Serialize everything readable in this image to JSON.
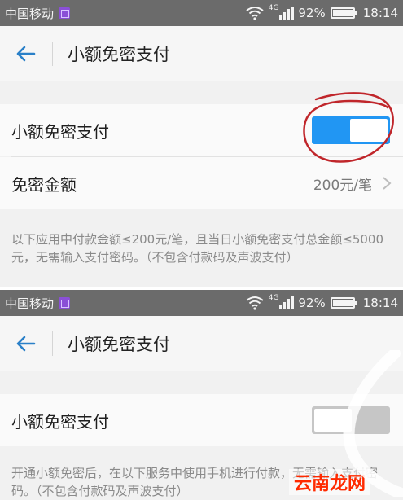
{
  "status_bar": {
    "carrier": "中国移动",
    "network": "4G",
    "battery": "92%",
    "battery_level": 0.92,
    "time": "18:14"
  },
  "header": {
    "title": "小额免密支付"
  },
  "top_screen": {
    "toggle_row_label": "小额免密支付",
    "toggle_on": true,
    "amount_row_label": "免密金额",
    "amount_value": "200元/笔",
    "note": "以下应用中付款金额≤200元/笔，且当日小额免密支付总金额≤5000元，无需输入支付密码。（不包含付款码及声波支付）"
  },
  "bottom_screen": {
    "toggle_row_label": "小额免密支付",
    "toggle_on": false,
    "note": "开通小额免密后，在以下服务中使用手机进行付款，无需输入支付密码。（不包含付款码及声波支付）"
  },
  "watermark": "云南龙网",
  "icons": {
    "back": "back-arrow-icon",
    "chevron": "chevron-right-icon",
    "wifi": "wifi-icon",
    "signal": "signal-icon",
    "battery": "battery-icon",
    "notification": "notification-icon"
  },
  "colors": {
    "accent": "#2196f3",
    "annotation": "#c0262b",
    "watermark": "#ff2a00"
  }
}
